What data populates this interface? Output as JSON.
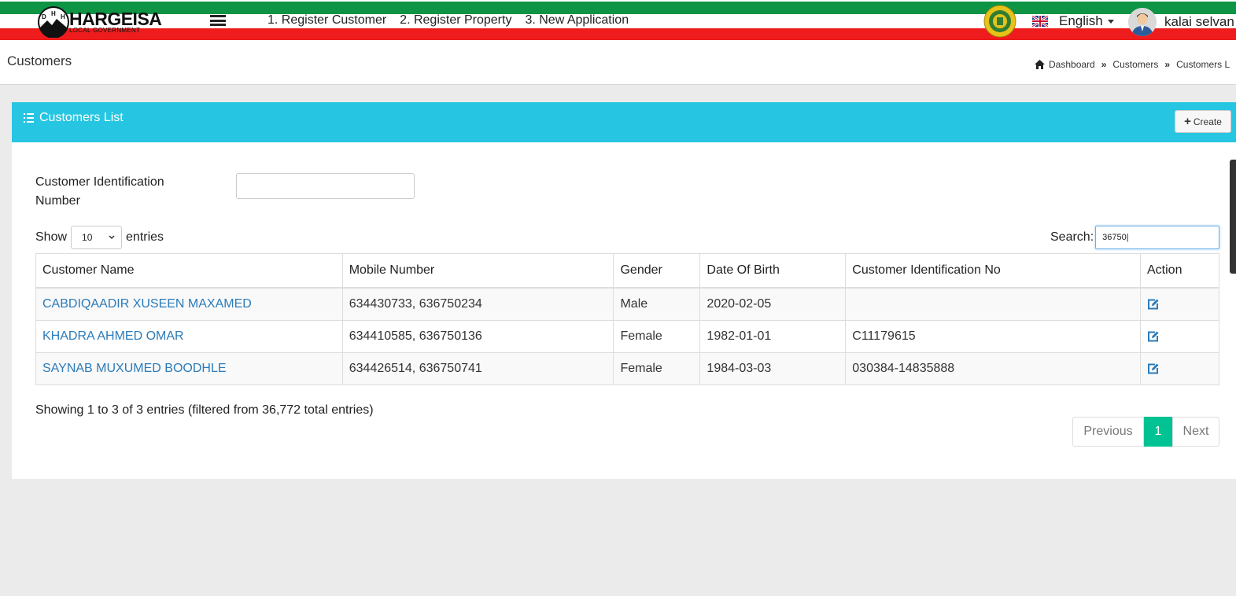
{
  "header": {
    "logo_title": "HARGEISA",
    "logo_subtitle": "LOCAL GOVERNMENT",
    "logo_mark_letters": "DHH",
    "nav": [
      "1. Register Customer",
      "2. Register Property",
      "3. New Application"
    ],
    "language": "English",
    "user_name": "kalai selvan"
  },
  "page": {
    "title": "Customers",
    "breadcrumb": [
      "Dashboard",
      "Customers",
      "Customers L"
    ]
  },
  "box": {
    "title": "Customers List",
    "create_label": "Create",
    "filter_label": "Customer Identification Number",
    "filter_value": "",
    "show_label": "Show",
    "show_value": "10",
    "entries_label": "entries",
    "search_label": "Search:",
    "search_value": "36750|"
  },
  "table": {
    "headers": [
      "Customer Name",
      "Mobile Number",
      "Gender",
      "Date Of Birth",
      "Customer Identification No",
      "Action"
    ],
    "rows": [
      {
        "name": "CABDIQAADIR XUSEEN MAXAMED",
        "mobile": "634430733, 636750234",
        "gender": "Male",
        "dob": "2020-02-05",
        "id_no": ""
      },
      {
        "name": "KHADRA AHMED OMAR",
        "mobile": "634410585, 636750136",
        "gender": "Female",
        "dob": "1982-01-01",
        "id_no": "C11179615"
      },
      {
        "name": "SAYNAB MUXUMED BOODHLE",
        "mobile": "634426514, 636750741",
        "gender": "Female",
        "dob": "1984-03-03",
        "id_no": "030384-14835888"
      }
    ]
  },
  "footer": {
    "info": "Showing 1 to 3 of 3 entries (filtered from 36,772 total entries)",
    "prev": "Previous",
    "current": "1",
    "next": "Next"
  },
  "colors": {
    "header_green": "#0d9444",
    "header_red": "#ee1c1c",
    "box_header": "#26c6e2",
    "link": "#2b7bb9",
    "pager_active": "#00c292"
  }
}
